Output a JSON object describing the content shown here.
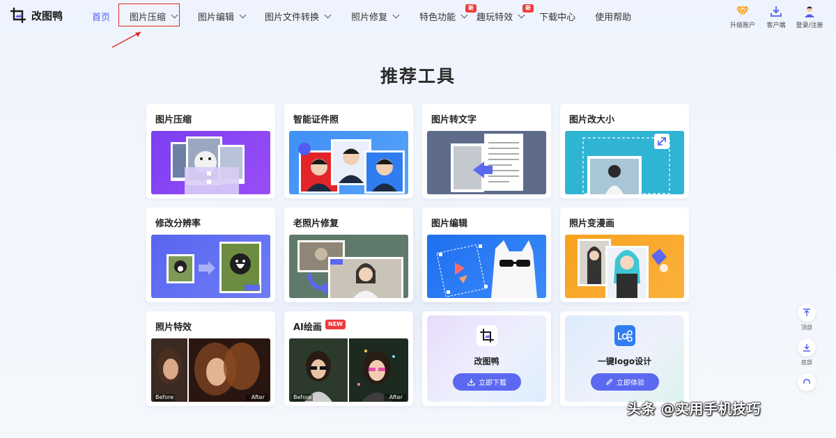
{
  "app": {
    "name": "改图鸭"
  },
  "nav": [
    {
      "label": "首页",
      "active": true,
      "chevron": false
    },
    {
      "label": "图片压缩",
      "chevron": true
    },
    {
      "label": "图片编辑",
      "chevron": true
    },
    {
      "label": "图片文件转换",
      "chevron": true
    },
    {
      "label": "照片修复",
      "chevron": true
    },
    {
      "label": "特色功能",
      "chevron": true,
      "badge": "新"
    },
    {
      "label": "趣玩特效",
      "chevron": true,
      "badge": "新"
    },
    {
      "label": "下载中心",
      "chevron": false
    },
    {
      "label": "使用帮助",
      "chevron": false
    }
  ],
  "header_tools": [
    {
      "label": "升级账户",
      "icon": "diamond-icon"
    },
    {
      "label": "客户端",
      "icon": "download-icon"
    },
    {
      "label": "登录/注册",
      "icon": "user-avatar-icon"
    }
  ],
  "page_title": "推荐工具",
  "tools": [
    {
      "title": "图片压缩"
    },
    {
      "title": "智能证件照"
    },
    {
      "title": "图片转文字"
    },
    {
      "title": "图片改大小"
    },
    {
      "title": "修改分辨率"
    },
    {
      "title": "老照片修复"
    },
    {
      "title": "图片编辑"
    },
    {
      "title": "照片变漫画"
    },
    {
      "title": "照片特效",
      "before": "Before",
      "after": "After"
    },
    {
      "title": "AI绘画",
      "tag": "NEW",
      "before": "Before",
      "after": "After"
    }
  ],
  "promos": [
    {
      "name": "改图鸭",
      "button": "立即下载"
    },
    {
      "name": "一键logo设计",
      "button": "立即体验"
    }
  ],
  "side_tools": [
    {
      "label": "顶部",
      "icon": "to-top-icon"
    },
    {
      "label": "底部",
      "icon": "to-bottom-icon"
    }
  ],
  "overlay": {
    "watermark": "头条 @实用手机技巧"
  },
  "colors": {
    "accent": "#4f5df0",
    "badge": "#ef3b3b",
    "highlight": "#e0281f"
  }
}
